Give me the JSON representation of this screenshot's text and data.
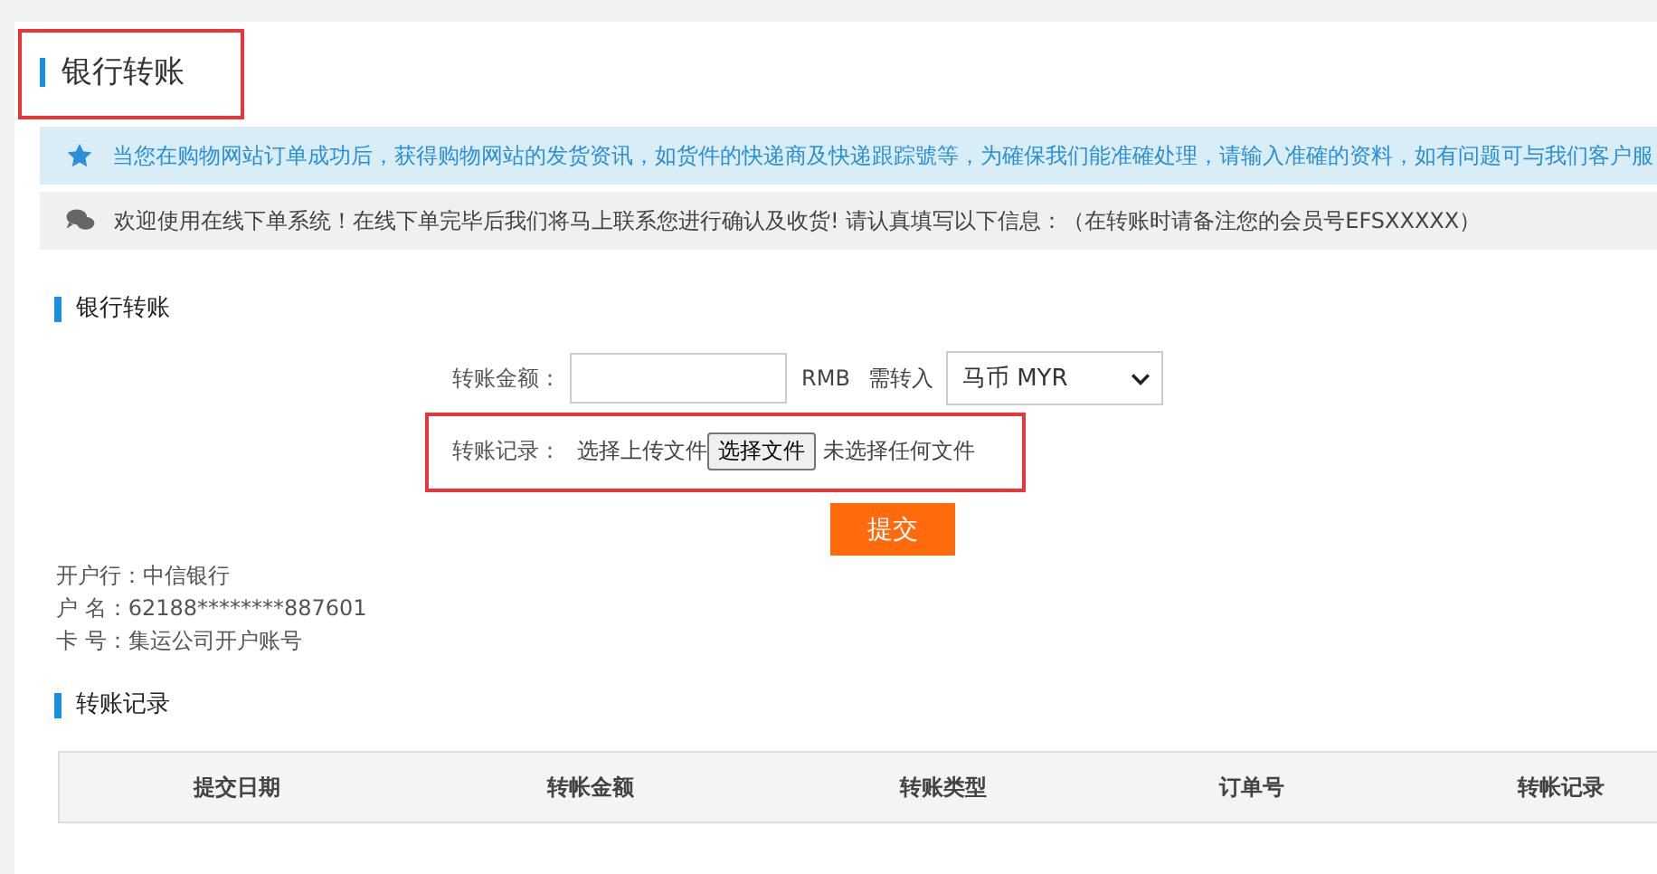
{
  "page_title": {
    "text": "银行转账",
    "highlighted": true
  },
  "notices": [
    {
      "kind": "info",
      "text": "当您在购物网站订单成功后，获得购物网站的发货资讯，如货件的快递商及快递跟踪號等，为確保我们能准確处理，请输入准確的资料，如有问题可与我们客户服"
    },
    {
      "kind": "chat",
      "text": "欢迎使用在线下单系统！在线下单完毕后我们将马上联系您进行确认及收货! 请认真填写以下信息：（在转账时请备注您的会员号EFSXXXXX）"
    }
  ],
  "form_section": {
    "title": "银行转账"
  },
  "form": {
    "amount_label": "转账金额：",
    "currency": "RMB",
    "convert_label": "需转入",
    "convert_select": "马币 MYR",
    "record_row": {
      "label": "转账记录：",
      "hint": "选择上传文件",
      "file_button": "选择文件",
      "file_status": "未选择任何文件",
      "highlighted": true
    },
    "submit": "提交"
  },
  "bank_info": [
    "开户行：中信银行",
    "户 名：62188********887601",
    "卡 号：集运公司开户账号"
  ],
  "records_section": {
    "title": "转账记录"
  },
  "table": {
    "columns": [
      "提交日期",
      "转帐金额",
      "转账类型",
      "订单号",
      "转帐记录"
    ]
  }
}
